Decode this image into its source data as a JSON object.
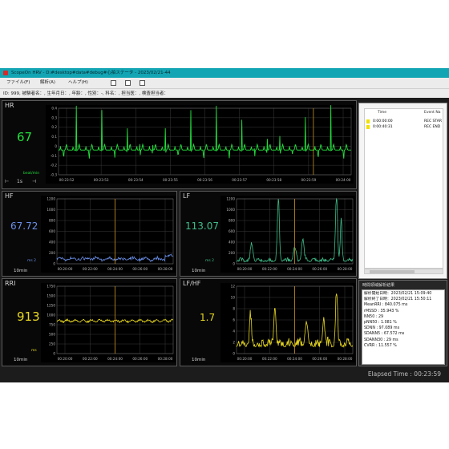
{
  "window": {
    "title": "ScopeOn HRV - D:#desktop#data#debug#心拍ステータ - 2023/02/21-44"
  },
  "menu": {
    "file": "ファイル(F)",
    "analysis": "解析(A)",
    "help": "ヘルプ(H)"
  },
  "info_bar": "ID: 999, 被験者名：, 生年月日：, 年齢：, 性別：-, 科名：, 担当医：, 検査担当者：",
  "hr_panel": {
    "title": "HR",
    "value": "67",
    "unit": "beat/min",
    "scale": "1s",
    "yticks": [
      "0.4",
      "0.3",
      "0.2",
      "0.1",
      "0",
      "-0.1",
      "-0.2",
      "-0.3"
    ],
    "xticks": [
      "00:23:52",
      "00:23:53",
      "00:23:54",
      "00:23:55",
      "00:23:56",
      "00:23:57",
      "00:23:58",
      "00:23:59",
      "00:24:00"
    ]
  },
  "hf_panel": {
    "title": "HF",
    "value": "67.72",
    "unit": "ms 2",
    "duration": "10min",
    "yticks": [
      "1200",
      "1000",
      "800",
      "600",
      "400",
      "200",
      "0"
    ],
    "xticks": [
      "00:20:00",
      "00:22:00",
      "00:24:00",
      "00:26:00",
      "00:28:00"
    ]
  },
  "lf_panel": {
    "title": "LF",
    "value": "113.07",
    "unit": "ms 2",
    "duration": "10min",
    "yticks": [
      "1200",
      "1000",
      "800",
      "600",
      "400",
      "200",
      "0"
    ],
    "xticks": [
      "00:20:00",
      "00:22:00",
      "00:24:00",
      "00:26:00",
      "00:28:00"
    ]
  },
  "rri_panel": {
    "title": "RRI",
    "value": "913",
    "unit": "ms",
    "duration": "10min",
    "yticks": [
      "1750",
      "1500",
      "1250",
      "1000",
      "750",
      "500",
      "250",
      "0"
    ],
    "xticks": [
      "00:20:00",
      "00:22:00",
      "00:24:00",
      "00:26:00",
      "00:28:00"
    ]
  },
  "lfhf_panel": {
    "title": "LF/HF",
    "value": "1.7",
    "duration": "10min",
    "yticks": [
      "12",
      "10",
      "8",
      "6",
      "4",
      "2",
      "0"
    ],
    "xticks": [
      "00:20:00",
      "00:22:00",
      "00:24:00",
      "00:26:00",
      "00:28:00"
    ]
  },
  "events": {
    "columns": [
      "Time",
      "Event Na"
    ],
    "rows": [
      {
        "time": "0:00:00:00",
        "name": "REC STAR"
      },
      {
        "time": "0:00:40:31",
        "name": "REC END"
      }
    ]
  },
  "results": {
    "title": "時間領域解析結果",
    "lines": [
      "解析開始日時：2023/02/21 15:09:40",
      "解析終了日時：2023/02/21 15:50:11",
      "MeanRRI : 840.075 ms",
      "rMSSD : 35.943 %",
      "NN50 : 29",
      "pNN50 : 1.081 %",
      "SDNN : 97.089 ms",
      "SDANN5 : 67.572 ms",
      "SDANN30 : 29 ms",
      "CVRR : 11.557 %"
    ]
  },
  "elapsed": "Elapsed Time : 00:23:59",
  "colors": {
    "hr": "#22e03c",
    "hf": "#6a8fe8",
    "lf": "#3fbe8a",
    "rri": "#e8d820",
    "lfhf": "#e8d820",
    "cursor": "#c8901a",
    "frame_bg": "#1c1c1c",
    "titlebar": "#13a5b4"
  }
}
